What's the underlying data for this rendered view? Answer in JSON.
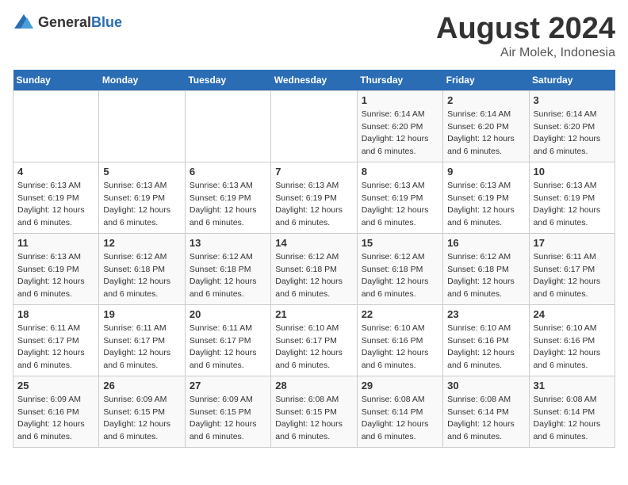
{
  "header": {
    "logo_general": "General",
    "logo_blue": "Blue",
    "title": "August 2024",
    "subtitle": "Air Molek, Indonesia"
  },
  "days_of_week": [
    "Sunday",
    "Monday",
    "Tuesday",
    "Wednesday",
    "Thursday",
    "Friday",
    "Saturday"
  ],
  "weeks": [
    [
      {
        "day": "",
        "info": ""
      },
      {
        "day": "",
        "info": ""
      },
      {
        "day": "",
        "info": ""
      },
      {
        "day": "",
        "info": ""
      },
      {
        "day": "1",
        "info": "Sunrise: 6:14 AM\nSunset: 6:20 PM\nDaylight: 12 hours\nand 6 minutes."
      },
      {
        "day": "2",
        "info": "Sunrise: 6:14 AM\nSunset: 6:20 PM\nDaylight: 12 hours\nand 6 minutes."
      },
      {
        "day": "3",
        "info": "Sunrise: 6:14 AM\nSunset: 6:20 PM\nDaylight: 12 hours\nand 6 minutes."
      }
    ],
    [
      {
        "day": "4",
        "info": "Sunrise: 6:13 AM\nSunset: 6:19 PM\nDaylight: 12 hours\nand 6 minutes."
      },
      {
        "day": "5",
        "info": "Sunrise: 6:13 AM\nSunset: 6:19 PM\nDaylight: 12 hours\nand 6 minutes."
      },
      {
        "day": "6",
        "info": "Sunrise: 6:13 AM\nSunset: 6:19 PM\nDaylight: 12 hours\nand 6 minutes."
      },
      {
        "day": "7",
        "info": "Sunrise: 6:13 AM\nSunset: 6:19 PM\nDaylight: 12 hours\nand 6 minutes."
      },
      {
        "day": "8",
        "info": "Sunrise: 6:13 AM\nSunset: 6:19 PM\nDaylight: 12 hours\nand 6 minutes."
      },
      {
        "day": "9",
        "info": "Sunrise: 6:13 AM\nSunset: 6:19 PM\nDaylight: 12 hours\nand 6 minutes."
      },
      {
        "day": "10",
        "info": "Sunrise: 6:13 AM\nSunset: 6:19 PM\nDaylight: 12 hours\nand 6 minutes."
      }
    ],
    [
      {
        "day": "11",
        "info": "Sunrise: 6:13 AM\nSunset: 6:19 PM\nDaylight: 12 hours\nand 6 minutes."
      },
      {
        "day": "12",
        "info": "Sunrise: 6:12 AM\nSunset: 6:18 PM\nDaylight: 12 hours\nand 6 minutes."
      },
      {
        "day": "13",
        "info": "Sunrise: 6:12 AM\nSunset: 6:18 PM\nDaylight: 12 hours\nand 6 minutes."
      },
      {
        "day": "14",
        "info": "Sunrise: 6:12 AM\nSunset: 6:18 PM\nDaylight: 12 hours\nand 6 minutes."
      },
      {
        "day": "15",
        "info": "Sunrise: 6:12 AM\nSunset: 6:18 PM\nDaylight: 12 hours\nand 6 minutes."
      },
      {
        "day": "16",
        "info": "Sunrise: 6:12 AM\nSunset: 6:18 PM\nDaylight: 12 hours\nand 6 minutes."
      },
      {
        "day": "17",
        "info": "Sunrise: 6:11 AM\nSunset: 6:17 PM\nDaylight: 12 hours\nand 6 minutes."
      }
    ],
    [
      {
        "day": "18",
        "info": "Sunrise: 6:11 AM\nSunset: 6:17 PM\nDaylight: 12 hours\nand 6 minutes."
      },
      {
        "day": "19",
        "info": "Sunrise: 6:11 AM\nSunset: 6:17 PM\nDaylight: 12 hours\nand 6 minutes."
      },
      {
        "day": "20",
        "info": "Sunrise: 6:11 AM\nSunset: 6:17 PM\nDaylight: 12 hours\nand 6 minutes."
      },
      {
        "day": "21",
        "info": "Sunrise: 6:10 AM\nSunset: 6:17 PM\nDaylight: 12 hours\nand 6 minutes."
      },
      {
        "day": "22",
        "info": "Sunrise: 6:10 AM\nSunset: 6:16 PM\nDaylight: 12 hours\nand 6 minutes."
      },
      {
        "day": "23",
        "info": "Sunrise: 6:10 AM\nSunset: 6:16 PM\nDaylight: 12 hours\nand 6 minutes."
      },
      {
        "day": "24",
        "info": "Sunrise: 6:10 AM\nSunset: 6:16 PM\nDaylight: 12 hours\nand 6 minutes."
      }
    ],
    [
      {
        "day": "25",
        "info": "Sunrise: 6:09 AM\nSunset: 6:16 PM\nDaylight: 12 hours\nand 6 minutes."
      },
      {
        "day": "26",
        "info": "Sunrise: 6:09 AM\nSunset: 6:15 PM\nDaylight: 12 hours\nand 6 minutes."
      },
      {
        "day": "27",
        "info": "Sunrise: 6:09 AM\nSunset: 6:15 PM\nDaylight: 12 hours\nand 6 minutes."
      },
      {
        "day": "28",
        "info": "Sunrise: 6:08 AM\nSunset: 6:15 PM\nDaylight: 12 hours\nand 6 minutes."
      },
      {
        "day": "29",
        "info": "Sunrise: 6:08 AM\nSunset: 6:14 PM\nDaylight: 12 hours\nand 6 minutes."
      },
      {
        "day": "30",
        "info": "Sunrise: 6:08 AM\nSunset: 6:14 PM\nDaylight: 12 hours\nand 6 minutes."
      },
      {
        "day": "31",
        "info": "Sunrise: 6:08 AM\nSunset: 6:14 PM\nDaylight: 12 hours\nand 6 minutes."
      }
    ]
  ]
}
